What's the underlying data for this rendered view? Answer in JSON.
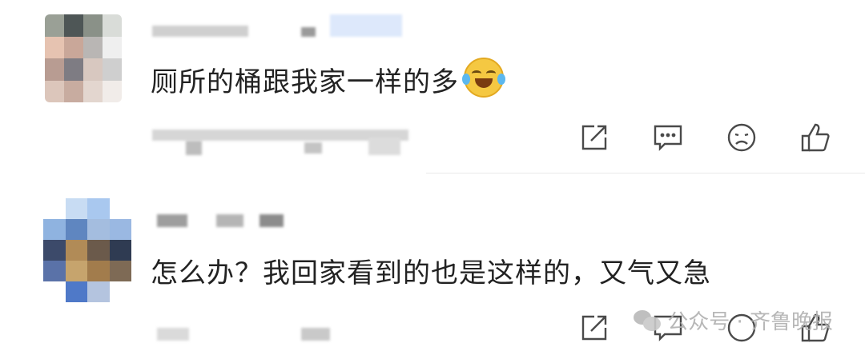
{
  "comments": [
    {
      "text": "厕所的桶跟我家一样的多",
      "emoji_icon": "laughing-crying-emoji-icon"
    },
    {
      "text": "怎么办？我回家看到的也是这样的，又气又急"
    }
  ],
  "actions": {
    "icons": [
      "share-icon",
      "reply-icon",
      "dislike-icon",
      "like-icon"
    ]
  },
  "watermark": {
    "text": "公众号 · 齐鲁晚报",
    "logo_icon": "wechat-logo-icon"
  },
  "colors": {
    "text": "#222222",
    "icon": "#4a4a4a",
    "watermark": "#b0b0b0",
    "divider": "#e9e9e9"
  }
}
